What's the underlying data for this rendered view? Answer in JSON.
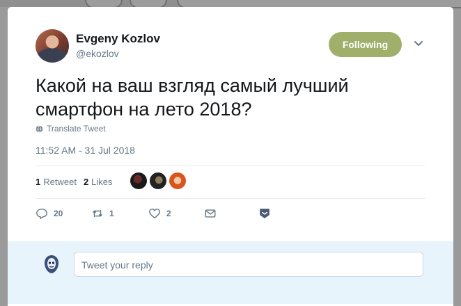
{
  "author": {
    "name": "Evgeny Kozlov",
    "handle": "@ekozlov",
    "follow_label": "Following"
  },
  "tweet": {
    "text": "Какой на ваш взгляд самый лучший смартфон на лето 2018?",
    "translate_label": "Translate Tweet",
    "timestamp": "11:52 AM - 31 Jul 2018"
  },
  "stats": {
    "retweet_count": "1",
    "retweet_label": "Retweet",
    "like_count": "2",
    "like_label": "Likes"
  },
  "actions": {
    "reply_count": "20",
    "retweet_count": "1",
    "like_count": "2"
  },
  "reply": {
    "placeholder": "Tweet your reply"
  },
  "colors": {
    "follow_button": "#a0b06a",
    "reply_bar": "#e8f4fb",
    "muted_text": "#657786",
    "main_text": "#14171a"
  }
}
